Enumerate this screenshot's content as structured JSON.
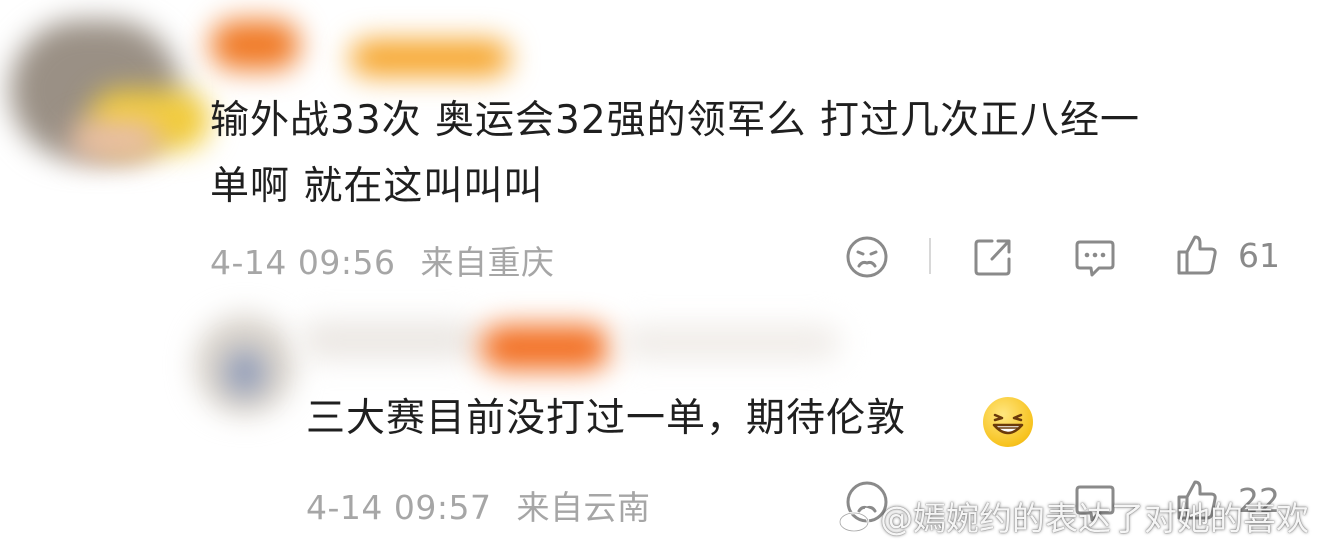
{
  "comment": {
    "text_line1": "输外战33次 奥运会32强的领军么 打过几次正八经一",
    "text_line2": "单啊 就在这叫叫叫",
    "time": "4-14 09:56",
    "location": "来自重庆",
    "like_count": "61"
  },
  "reply": {
    "text": "三大赛目前没打过一单，期待伦敦",
    "emoji": "grinning-squint-emoji",
    "time": "4-14 09:57",
    "location": "来自云南",
    "like_count": "22"
  },
  "watermark": "@嫣婉约的表达了对她的喜欢",
  "icons": {
    "dislike": "frown-face-icon",
    "share": "share-icon",
    "reply": "comment-bubble-icon",
    "like": "thumbs-up-icon"
  }
}
